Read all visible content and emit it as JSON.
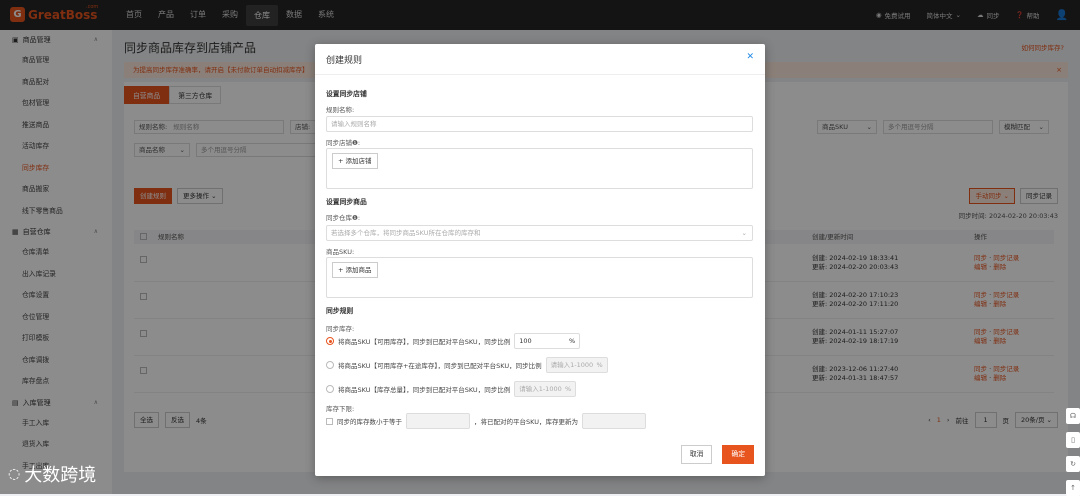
{
  "app": {
    "logo": "GreatBoss",
    "logo_suffix": ".com"
  },
  "nav": [
    "首页",
    "产品",
    "订单",
    "采购",
    "仓库",
    "数据",
    "系统"
  ],
  "nav_active": 4,
  "topright": {
    "trial": "免费试用",
    "lang": "简体中文",
    "sync": "同步",
    "help": "帮助"
  },
  "sidebar": {
    "groups": [
      {
        "label": "商品管理",
        "items": [
          "商品管理",
          "商品配对",
          "包材管理",
          "推送商品",
          "活动库存",
          "同步库存",
          "商品搬家",
          "线下零售商品"
        ]
      },
      {
        "label": "自营仓库",
        "items": [
          "仓库清单",
          "出入库记录",
          "仓库设置",
          "仓位管理",
          "打印模板",
          "仓库调拨",
          "库存盘点"
        ]
      },
      {
        "label": "入库管理",
        "items": [
          "手工入库",
          "退货入库",
          "手工出库"
        ]
      }
    ],
    "active_item": "同步库存"
  },
  "page": {
    "title": "同步商品库存到店铺产品",
    "help_link": "如何同步库存?",
    "notice": "为提高同步库存准确率，请开启【未付款订单自动扣减库存】",
    "tabs": [
      "自营商品",
      "第三方仓库"
    ],
    "filters": {
      "rule_name_label": "规则名称:",
      "rule_name_ph": "规则名称",
      "shop_label": "店铺:",
      "sku_select": "商品SKU",
      "sku_ph": "多个用逗号分隔",
      "match": "模糊匹配",
      "goods_select": "商品名称",
      "goods_ph": "多个用逗号分隔"
    },
    "actions": {
      "create": "创建规则",
      "more": "更多操作",
      "manual_sync": "手动同步",
      "sync_record": "同步记录",
      "sync_time_label": "同步时间:",
      "sync_time": "2024-02-20 20:03:43"
    },
    "table": {
      "headers": {
        "name": "规则名称",
        "time": "创建/更新时间",
        "ops": "操作"
      },
      "rows": [
        {
          "created": "2024-02-19 18:33:41",
          "updated": "2024-02-20 20:03:43"
        },
        {
          "created": "2024-02-20 17:10:23",
          "updated": "2024-02-20 17:11:20"
        },
        {
          "created": "2024-01-11 15:27:07",
          "updated": "2024-02-19 18:17:19"
        },
        {
          "created": "2023-12-06 11:27:40",
          "updated": "2024-01-31 18:47:57"
        }
      ],
      "created_label": "创建:",
      "updated_label": "更新:",
      "op_sync": "同步",
      "op_record": "同步记录",
      "op_edit": "编辑",
      "op_delete": "删除"
    },
    "footer": {
      "select_all": "全选",
      "invert": "反选",
      "count": "4条",
      "page": "1",
      "goto": "前往",
      "goto_page": "1",
      "page_unit": "页",
      "page_size": "20条/页"
    }
  },
  "modal": {
    "title": "创建规则",
    "sec_shop": "设置同步店铺",
    "rule_name_label": "规则名称:",
    "rule_name_ph": "请输入规则名称",
    "shop_label": "同步店铺❶:",
    "add_shop": "+ 添加店铺",
    "sec_goods": "设置同步商品",
    "warehouse_label": "同步仓库❶:",
    "warehouse_ph": "若选择多个仓库，将同步商品SKU所在仓库的库存和",
    "sku_label": "商品SKU:",
    "add_goods": "+ 添加商品",
    "sec_rule": "同步规则",
    "stock_label": "同步库存:",
    "opt1": "将商品SKU【可用库存】，同步到已配对平台SKU，同步比例",
    "opt1_value": "100",
    "opt2": "将商品SKU【可用库存+在途库存】，同步到已配对平台SKU，同步比例",
    "opt2_ph": "请输入1-1000",
    "opt3": "将商品SKU【库存总量】，同步到已配对平台SKU，同步比例",
    "opt3_ph": "请输入1-1000",
    "percent": "%",
    "lower_label": "库存下限:",
    "lower_text1": "同步的库存数小于等于",
    "lower_text2": "，将已配对的平台SKU，库存更新为",
    "cancel": "取消",
    "confirm": "确定"
  },
  "watermark": "大数跨境",
  "colors": {
    "accent": "#e8541e",
    "topbar": "#262626"
  }
}
